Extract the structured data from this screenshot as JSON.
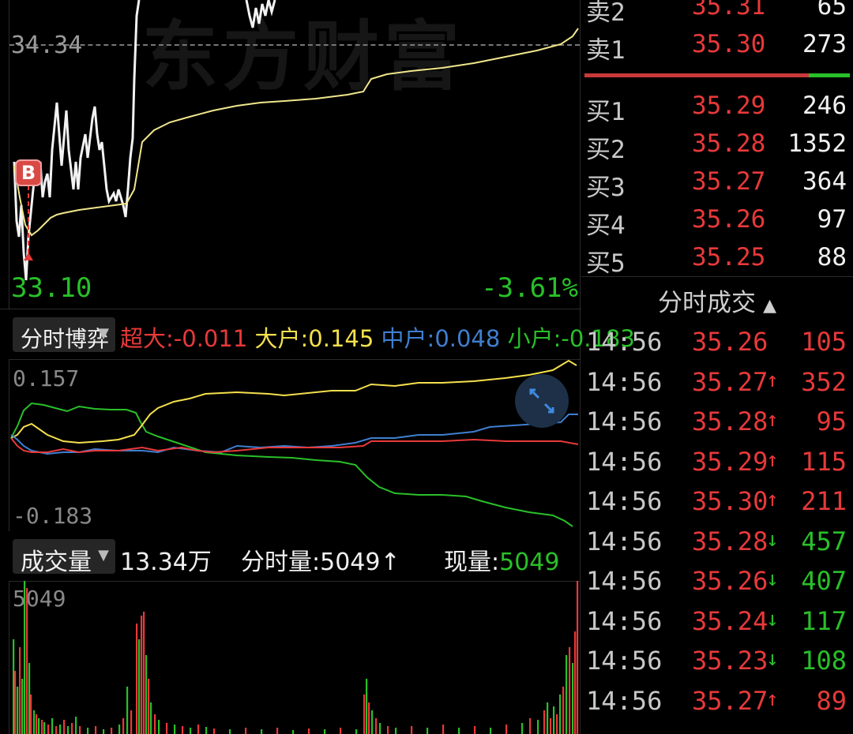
{
  "price_chart": {
    "watermark": "东方财富",
    "ref_price": "34.34",
    "low_price": "33.10",
    "change_pct": "-3.61%",
    "buy_marker": "B"
  },
  "indicator": {
    "selector_label": "分时博弈",
    "super_label": "超大",
    "super_value": ":-0.011",
    "large_label": "大户",
    "large_value": ":0.145",
    "mid_label": "中户",
    "mid_value": ":0.048",
    "small_label": "小户",
    "small_value": ":-0.183",
    "axis_max": "0.157",
    "axis_min": "-0.183",
    "colors": {
      "super": "#e8393a",
      "large": "#f4e04d",
      "mid": "#3f7fd0",
      "small": "#29c029"
    }
  },
  "volume": {
    "selector_label": "成交量",
    "total": "13.34万",
    "minute_label": "分时量:",
    "minute_value": "5049",
    "minute_arrow": "↑",
    "current_label": "现量:",
    "current_value": "5049",
    "axis_max": "5049"
  },
  "order_book": {
    "asks": [
      {
        "label": "卖2",
        "price": "35.31",
        "qty": "65"
      },
      {
        "label": "卖1",
        "price": "35.30",
        "qty": "273"
      }
    ],
    "bids": [
      {
        "label": "买1",
        "price": "35.29",
        "qty": "246"
      },
      {
        "label": "买2",
        "price": "35.28",
        "qty": "1352"
      },
      {
        "label": "买3",
        "price": "35.27",
        "qty": "364"
      },
      {
        "label": "买4",
        "price": "35.26",
        "qty": "97"
      },
      {
        "label": "买5",
        "price": "35.25",
        "qty": "88"
      }
    ]
  },
  "trades": {
    "header": "分时成交",
    "rows": [
      {
        "time": "14:56",
        "price": "35.26",
        "arrow": "",
        "qty": "105",
        "dir": "up"
      },
      {
        "time": "14:56",
        "price": "35.27",
        "arrow": "↑",
        "qty": "352",
        "dir": "up"
      },
      {
        "time": "14:56",
        "price": "35.28",
        "arrow": "↑",
        "qty": "95",
        "dir": "up"
      },
      {
        "time": "14:56",
        "price": "35.29",
        "arrow": "↑",
        "qty": "115",
        "dir": "up"
      },
      {
        "time": "14:56",
        "price": "35.30",
        "arrow": "↑",
        "qty": "211",
        "dir": "up"
      },
      {
        "time": "14:56",
        "price": "35.28",
        "arrow": "↓",
        "qty": "457",
        "dir": "down"
      },
      {
        "time": "14:56",
        "price": "35.26",
        "arrow": "↓",
        "qty": "407",
        "dir": "down"
      },
      {
        "time": "14:56",
        "price": "35.24",
        "arrow": "↓",
        "qty": "117",
        "dir": "down"
      },
      {
        "time": "14:56",
        "price": "35.23",
        "arrow": "↓",
        "qty": "108",
        "dir": "down"
      },
      {
        "time": "14:56",
        "price": "35.27",
        "arrow": "↑",
        "qty": "89",
        "dir": "up"
      }
    ]
  },
  "colors": {
    "up": "#e8393a",
    "down": "#29c029",
    "avg": "#f0e68c",
    "price": "#f2f2f2"
  }
}
